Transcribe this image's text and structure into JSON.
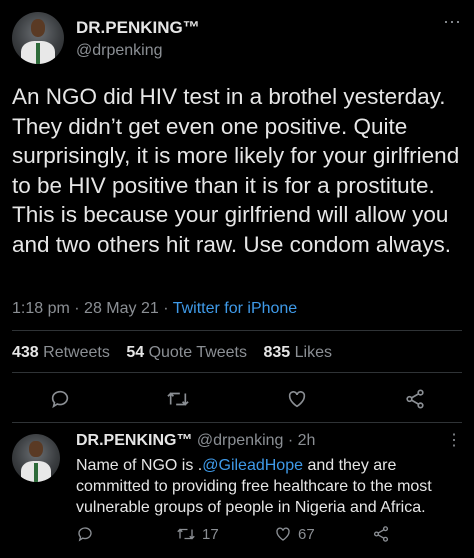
{
  "tweet": {
    "display_name": "DR.PENKING™",
    "handle": "@drpenking",
    "more_icon": "more-icon",
    "text": "An NGO did HIV test in a brothel yesterday. They didn’t get even one positive. Quite surprisingly, it is more likely for your girlfriend to be HIV positive than it is for a prostitute. This is because your girlfriend will allow you and two others hit raw. Use condom always.",
    "time": "1:18 pm",
    "date": "28 May 21",
    "source": "Twitter for iPhone",
    "stats": {
      "retweets_count": "438",
      "retweets_label": "Retweets",
      "quotes_count": "54",
      "quotes_label": "Quote Tweets",
      "likes_count": "835",
      "likes_label": "Likes"
    }
  },
  "reply": {
    "display_name": "DR.PENKING™",
    "handle": "@drpenking",
    "age": "2h",
    "text_before": "Name of NGO is .",
    "mention": "@GileadHope",
    "text_after": " and they are committed to providing free healthcare to the most vulnerable groups of people in Nigeria and Africa.",
    "retweets": "17",
    "likes": "67"
  },
  "colors": {
    "background": "#000000",
    "text": "#e6e6e6",
    "muted": "#8b8f94",
    "link": "#3f9ae8",
    "divider": "#2f3336"
  }
}
